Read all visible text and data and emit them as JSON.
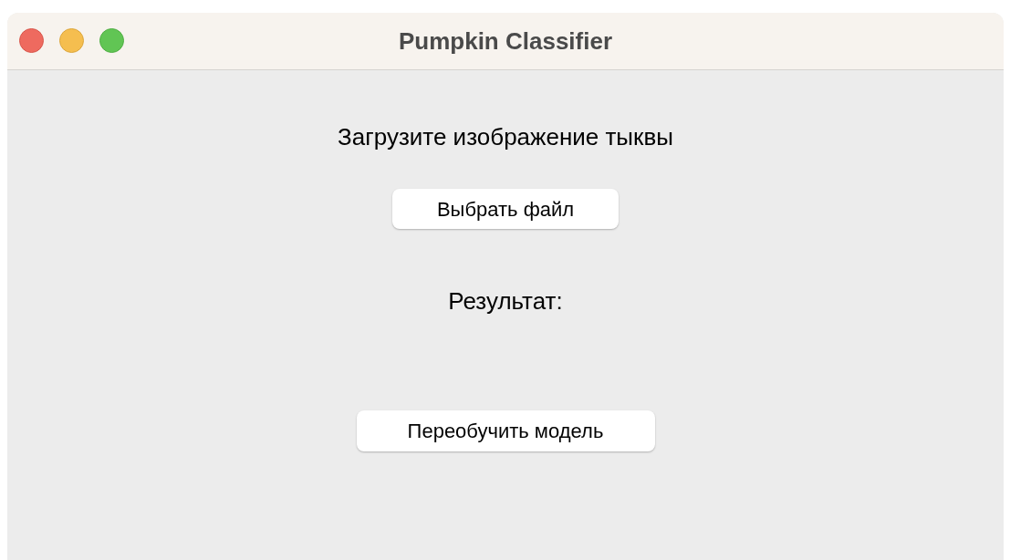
{
  "window": {
    "title": "Pumpkin Classifier"
  },
  "prompt": "Загрузите изображение тыквы",
  "choose_button": {
    "label": "Выбрать файл"
  },
  "result_label": "Результат:",
  "retrain_button": {
    "label": "Переобучить модель"
  }
}
